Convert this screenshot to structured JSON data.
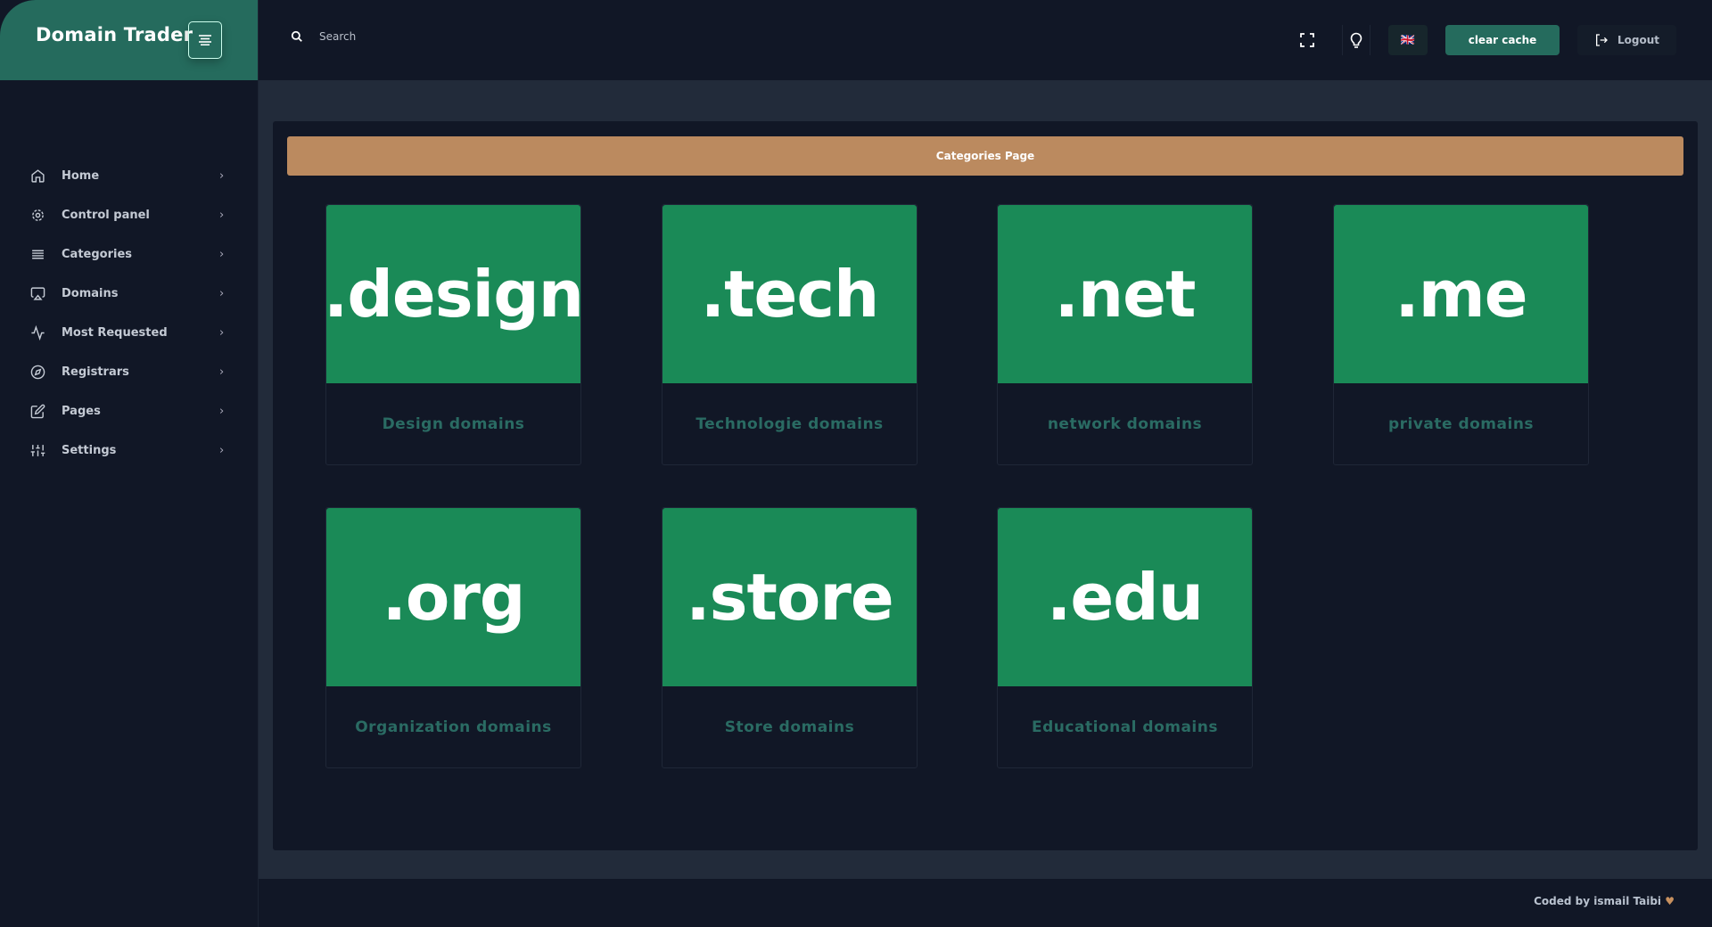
{
  "brand": {
    "title": "Domain Trader"
  },
  "search": {
    "placeholder": "Search"
  },
  "header": {
    "clear_cache": "clear cache",
    "logout": "Logout",
    "flag": "🇬🇧"
  },
  "sidebar": {
    "items": [
      {
        "label": "Home",
        "icon": "home-icon"
      },
      {
        "label": "Control panel",
        "icon": "gear-icon"
      },
      {
        "label": "Categories",
        "icon": "list-icon"
      },
      {
        "label": "Domains",
        "icon": "monitor-icon"
      },
      {
        "label": "Most Requested",
        "icon": "activity-icon"
      },
      {
        "label": "Registrars",
        "icon": "compass-icon"
      },
      {
        "label": "Pages",
        "icon": "edit-icon"
      },
      {
        "label": "Settings",
        "icon": "sliders-icon"
      }
    ]
  },
  "page": {
    "banner": "Categories Page"
  },
  "categories": [
    {
      "tld": ".design",
      "label": "Design domains"
    },
    {
      "tld": ".tech",
      "label": "Technologie domains"
    },
    {
      "tld": ".net",
      "label": "network domains"
    },
    {
      "tld": ".me",
      "label": "private domains"
    },
    {
      "tld": ".org",
      "label": "Organization domains"
    },
    {
      "tld": ".store",
      "label": "Store domains"
    },
    {
      "tld": ".edu",
      "label": "Educational domains"
    }
  ],
  "footer": {
    "text": "Coded by ismail Taibi"
  },
  "colors": {
    "accent": "#256b5d",
    "card": "#1a8a57",
    "banner": "#bb8a5f"
  }
}
